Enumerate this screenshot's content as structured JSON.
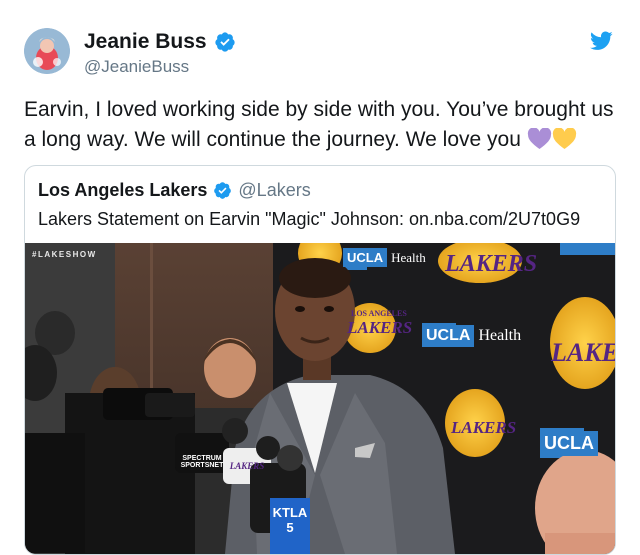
{
  "author": {
    "name": "Jeanie Buss",
    "handle": "@JeanieBuss",
    "verified": true
  },
  "tweet": {
    "text": "Earvin, I loved working side by side with you. You’ve brought us a long way. We will continue the journey. We love you",
    "emojis": [
      "purple-heart-emoji",
      "yellow-heart-emoji"
    ]
  },
  "quoted": {
    "name": "Los Angeles Lakers",
    "handle": "@Lakers",
    "verified": true,
    "text": "Lakers Statement on Earvin \"Magic\" Johnson: on.nba.com/2U7t0G9",
    "photo": {
      "tag": "#LAKESHOW",
      "ucla_box": "UCLA",
      "ucla_health": "Health",
      "lakers_word": "LAKERS",
      "angeles_word": "LOS ANGELES",
      "mic_flag_1": "SPECTRUM SPORTSNET",
      "mic_flag_2": "KTLA 5",
      "mic_flag_3": "LAKERS"
    }
  },
  "colors": {
    "twitter_blue": "#1da1f2",
    "verified_blue": "#1d9bf0",
    "handle_gray": "#657786",
    "border": "#cfd9de",
    "lakers_purple": "#552583",
    "lakers_gold": "#fdb927",
    "ucla_blue": "#2e7dc7"
  }
}
